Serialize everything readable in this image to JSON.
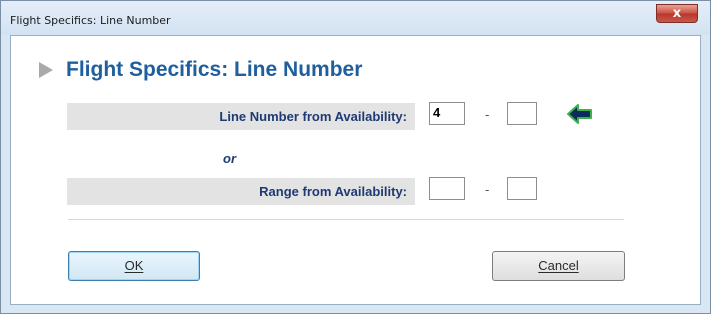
{
  "window": {
    "title": "Flight Specifics: Line Number",
    "close_label": "x"
  },
  "dialog": {
    "heading": "Flight Specifics: Line Number",
    "line_number_label": "Line Number from Availability:",
    "line_number_from": "4",
    "line_number_to": "",
    "separator_or": "or",
    "range_label": "Range from Availability:",
    "range_from": "",
    "range_to": "",
    "dash": "-"
  },
  "buttons": {
    "ok_label": "OK",
    "cancel_label": "Cancel"
  },
  "colors": {
    "heading": "#1f5f9e",
    "label": "#1f3a73",
    "arrow_icon": "#0d2a5c",
    "arrow_icon_outline": "#3bb34a"
  }
}
